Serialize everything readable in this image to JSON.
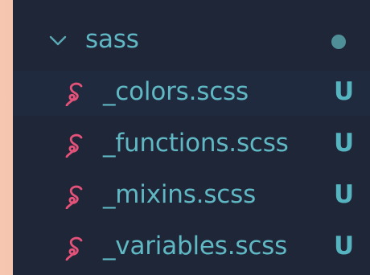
{
  "explorer": {
    "folder": {
      "name": "sass",
      "icon": "chevron-down-icon",
      "status_dot_color": "#4e8f98"
    },
    "files": [
      {
        "name": "_colors.scss",
        "status": "U",
        "icon": "sass-icon"
      },
      {
        "name": "_functions.scss",
        "status": "U",
        "icon": "sass-icon"
      },
      {
        "name": "_mixins.scss",
        "status": "U",
        "icon": "sass-icon"
      },
      {
        "name": "_variables.scss",
        "status": "U",
        "icon": "sass-icon"
      }
    ]
  },
  "colors": {
    "text": "#5fb8c3",
    "sass_icon": "#e4527a",
    "panel_bg": "#1f2637",
    "selected_row_bg": "#202a3e"
  }
}
